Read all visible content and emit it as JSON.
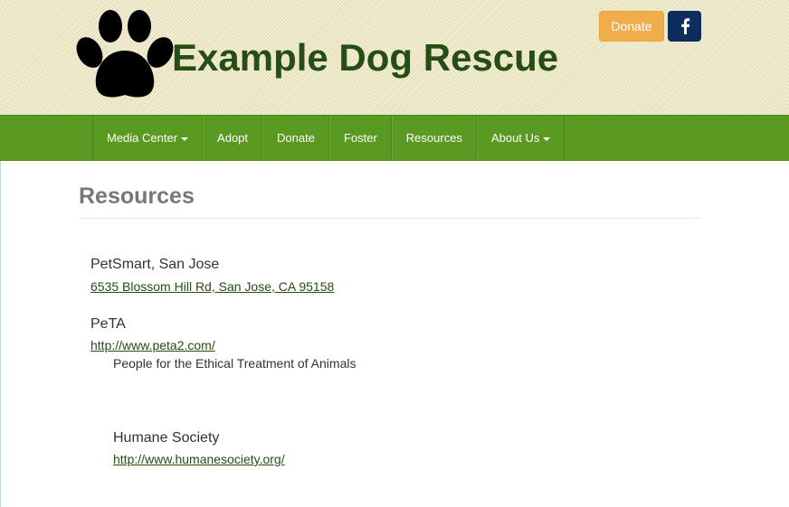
{
  "header": {
    "site_title": "Example Dog Rescue",
    "donate_label": "Donate",
    "facebook_icon": "facebook-icon",
    "logo_icon": "paw-print-icon"
  },
  "nav": {
    "items": [
      {
        "label": "Media Center",
        "dropdown": true
      },
      {
        "label": "Adopt",
        "dropdown": false
      },
      {
        "label": "Donate",
        "dropdown": false
      },
      {
        "label": "Foster",
        "dropdown": false
      },
      {
        "label": "Resources",
        "dropdown": false
      },
      {
        "label": "About Us",
        "dropdown": true
      }
    ]
  },
  "main": {
    "title": "Resources",
    "resources": [
      {
        "name": "PetSmart, San Jose",
        "link": "6535 Blossom Hill Rd, San Jose, CA 95158",
        "description": ""
      },
      {
        "name": "PeTA",
        "link": "http://www.peta2.com/",
        "description": "People for the Ethical Treatment of Animals"
      },
      {
        "name": "Humane Society",
        "link": "http://www.humanesociety.org/",
        "description": ""
      }
    ]
  },
  "colors": {
    "brand_green": "#254d14",
    "nav_green": "#5a9a22",
    "donate_orange": "#f0ad4e",
    "facebook_blue": "#0d2d5e"
  }
}
